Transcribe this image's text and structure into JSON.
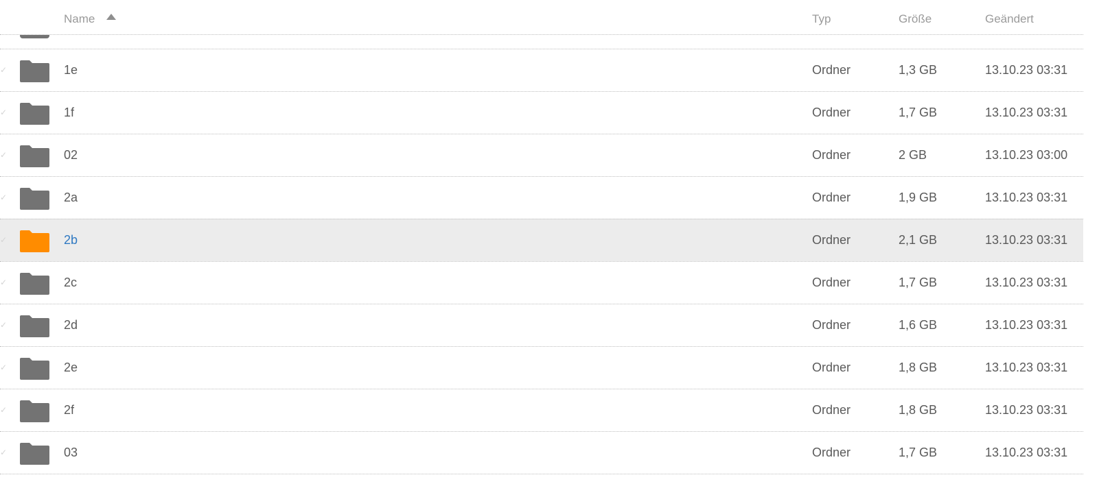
{
  "header": {
    "name": "Name",
    "type": "Typ",
    "size": "Größe",
    "modified": "Geändert"
  },
  "colors": {
    "folder_default": "#737373",
    "folder_selected": "#ff8c00",
    "selected_row_bg": "#ececec",
    "selected_name": "#2f79c2"
  },
  "rows": [
    {
      "name": "1e",
      "type": "Ordner",
      "size": "1,3 GB",
      "modified": "13.10.23 03:31",
      "icon": "folder-icon"
    },
    {
      "name": "1f",
      "type": "Ordner",
      "size": "1,7 GB",
      "modified": "13.10.23 03:31",
      "icon": "folder-icon"
    },
    {
      "name": "02",
      "type": "Ordner",
      "size": "2 GB",
      "modified": "13.10.23 03:00",
      "icon": "folder-icon"
    },
    {
      "name": "2a",
      "type": "Ordner",
      "size": "1,9 GB",
      "modified": "13.10.23 03:31",
      "icon": "folder-icon"
    },
    {
      "name": "2b",
      "type": "Ordner",
      "size": "2,1 GB",
      "modified": "13.10.23 03:31",
      "icon": "folder-icon",
      "selected": true
    },
    {
      "name": "2c",
      "type": "Ordner",
      "size": "1,7 GB",
      "modified": "13.10.23 03:31",
      "icon": "folder-icon"
    },
    {
      "name": "2d",
      "type": "Ordner",
      "size": "1,6 GB",
      "modified": "13.10.23 03:31",
      "icon": "folder-icon"
    },
    {
      "name": "2e",
      "type": "Ordner",
      "size": "1,8 GB",
      "modified": "13.10.23 03:31",
      "icon": "folder-icon"
    },
    {
      "name": "2f",
      "type": "Ordner",
      "size": "1,8 GB",
      "modified": "13.10.23 03:31",
      "icon": "folder-icon"
    },
    {
      "name": "03",
      "type": "Ordner",
      "size": "1,7 GB",
      "modified": "13.10.23 03:31",
      "icon": "folder-icon"
    }
  ]
}
